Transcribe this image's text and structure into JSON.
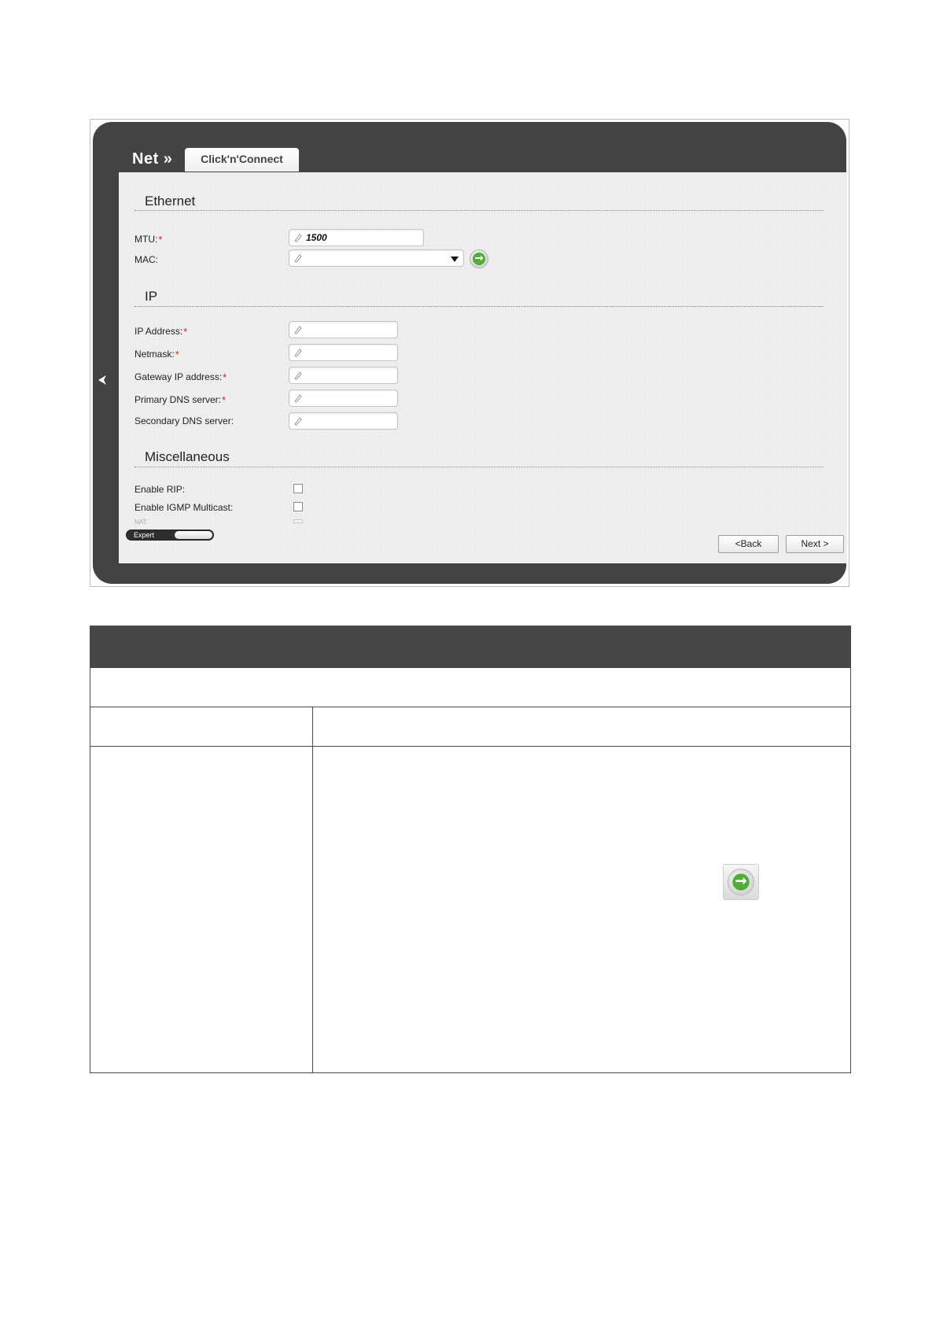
{
  "header": {
    "section": "Net »",
    "tab_label": "Click'n'Connect"
  },
  "ethernet": {
    "title": "Ethernet",
    "mtu": {
      "label": "MTU:",
      "required": "*",
      "value": "1500"
    },
    "mac": {
      "label": "MAC:",
      "value": ""
    }
  },
  "ip": {
    "title": "IP",
    "ip_address": {
      "label": "IP Address:",
      "required": "*",
      "value": ""
    },
    "netmask": {
      "label": "Netmask:",
      "required": "*",
      "value": ""
    },
    "gateway": {
      "label": "Gateway IP address:",
      "required": "*",
      "value": ""
    },
    "primary_dns": {
      "label": "Primary DNS server:",
      "required": "*",
      "value": ""
    },
    "secondary_dns": {
      "label": "Secondary DNS server:",
      "value": ""
    }
  },
  "misc": {
    "title": "Miscellaneous",
    "enable_rip": {
      "label": "Enable RIP:",
      "checked": false
    },
    "enable_igmp": {
      "label": "Enable IGMP Multicast:",
      "checked": false
    },
    "nat": {
      "label": "NAT:"
    }
  },
  "footer": {
    "expert_label": "Expert",
    "back_label": "<Back",
    "next_label": "Next >"
  },
  "colors": {
    "shell": "#434343",
    "panel": "#eeeeee",
    "required": "#d81f1f",
    "go_arrow": "#3d9b2b"
  },
  "icons": {
    "collapse": "chevron-left-icon",
    "field_edit": "pencil-icon",
    "mac_clone": "green-arrows-icon",
    "dropdown": "triangle-down-icon"
  }
}
